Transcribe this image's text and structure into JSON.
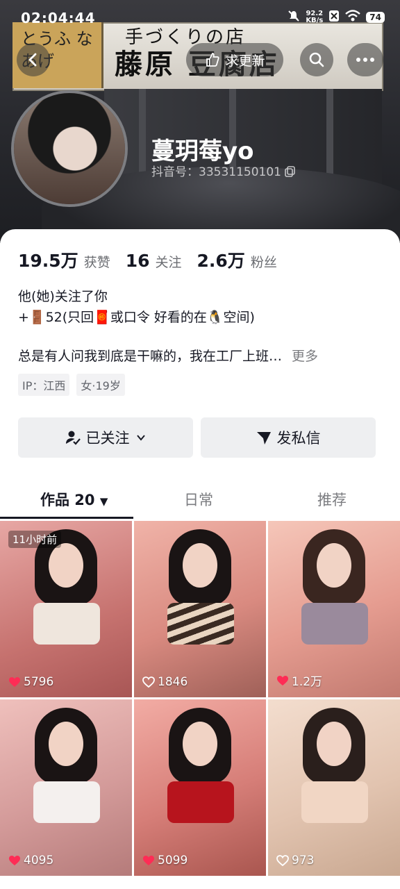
{
  "status_bar": {
    "time": "02:04:44",
    "net_speed_value": "92.2",
    "net_speed_unit": "KB/s",
    "battery": "74"
  },
  "header": {
    "update_label": "求更新"
  },
  "banner": {
    "sign_small": "手づくりの店",
    "sign_big": "藤原 豆腐店",
    "sign_left": "とうふ なあげ"
  },
  "profile": {
    "name": "蔓玥莓yo",
    "douyin_id": "抖音号：33531150101",
    "stats": [
      {
        "num": "19.5万",
        "label": "获赞"
      },
      {
        "num": "16",
        "label": "关注"
      },
      {
        "num": "2.6万",
        "label": "粉丝"
      }
    ],
    "bio_line1": "他(她)关注了你",
    "bio_line2": "+🚪52(只回🧧或口令 好看的在🐧空间)",
    "desc": "总是有人问我到底是干嘛的，我在工厂上班…",
    "desc_more": "更多",
    "tags": [
      "IP：江西",
      "女·19岁"
    ]
  },
  "actions": {
    "follow": "已关注",
    "message": "发私信"
  },
  "tabs": {
    "works": "作品 20",
    "daily": "日常",
    "recommend": "推荐"
  },
  "videos": [
    {
      "likes": "5796",
      "liked": true,
      "badge": "11小时前"
    },
    {
      "likes": "1846",
      "liked": false,
      "badge": ""
    },
    {
      "likes": "1.2万",
      "liked": true,
      "badge": ""
    },
    {
      "likes": "4095",
      "liked": true,
      "badge": ""
    },
    {
      "likes": "5099",
      "liked": true,
      "badge": ""
    },
    {
      "likes": "973",
      "liked": false,
      "badge": ""
    }
  ],
  "icons": {
    "back": "chevron-left-icon",
    "search": "search-icon",
    "more": "more-dots-icon",
    "copy": "copy-icon"
  },
  "colors": {
    "like_red": "#fe2c55",
    "text": "#161823",
    "muted": "#7b7c80"
  }
}
